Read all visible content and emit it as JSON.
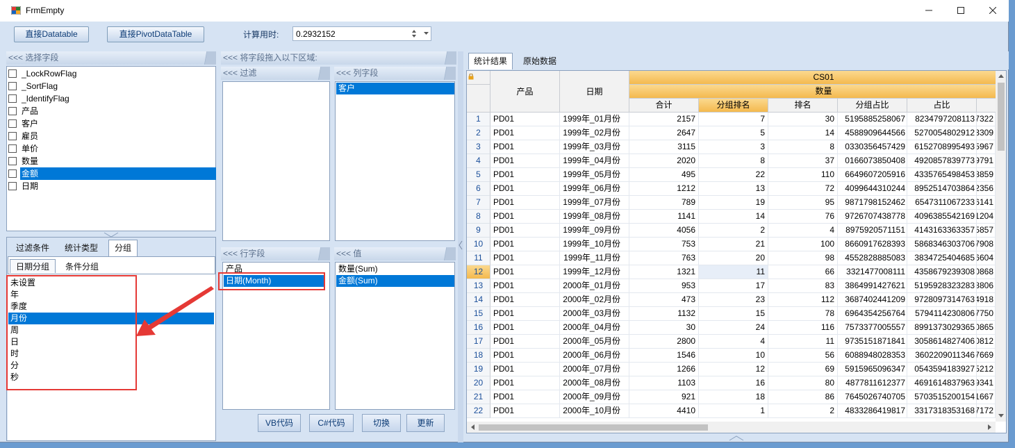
{
  "window": {
    "title": "FrmEmpty"
  },
  "toolbar": {
    "btn_datatable": "直接Datatable",
    "btn_pivot": "直接PivotDataTable",
    "calc_time_label": "计算用时:",
    "calc_time_value": "0.2932152"
  },
  "field_panel": {
    "header": "<<< 选择字段",
    "fields": [
      "_LockRowFlag",
      "_SortFlag",
      "_IdentifyFlag",
      "产品",
      "客户",
      "雇员",
      "单价",
      "数量",
      "金额",
      "日期"
    ],
    "selected_index": 8
  },
  "drag_header": "<<< 将字段拖入以下区域:",
  "filter_area": {
    "header": "<<< 过滤",
    "items": []
  },
  "column_area": {
    "header": "<<< 列字段",
    "items": [
      "客户"
    ]
  },
  "row_area": {
    "header": "<<< 行字段",
    "items": [
      "产品",
      "日期(Month)"
    ]
  },
  "value_area": {
    "header": "<<< 值",
    "items": [
      "数量(Sum)",
      "金额(Sum)"
    ]
  },
  "bottom_tabs": {
    "tabs": [
      "过滤条件",
      "统计类型",
      "分组"
    ],
    "active": 2,
    "subtabs": [
      "日期分组",
      "条件分组"
    ],
    "sub_active": 0
  },
  "group_options": {
    "items": [
      "未设置",
      "年",
      "季度",
      "月份",
      "周",
      "日",
      "时",
      "分",
      "秒"
    ],
    "selected_index": 3
  },
  "action_buttons": {
    "vb": "VB代码",
    "cs": "C#代码",
    "switch": "切换",
    "refresh": "更新"
  },
  "result_tabs": {
    "tabs": [
      "统计结果",
      "原始数据"
    ],
    "active": 0
  },
  "grid": {
    "col_product": "产品",
    "col_date": "日期",
    "band_top": "CS01",
    "band_mid": "数量",
    "subcols": [
      "合计",
      "分组排名",
      "排名",
      "分组占比",
      "占比"
    ],
    "rows": [
      {
        "n": "1",
        "p": "PD01",
        "d": "1999年_01月份",
        "t": "2157",
        "gr": "7",
        "r": "30",
        "gp": "5195885258067",
        "pp": "8234797208113",
        "x": "7322"
      },
      {
        "n": "2",
        "p": "PD01",
        "d": "1999年_02月份",
        "t": "2647",
        "gr": "5",
        "r": "14",
        "gp": "4588909644566",
        "pp": "5270054802912",
        "x": "3309"
      },
      {
        "n": "3",
        "p": "PD01",
        "d": "1999年_03月份",
        "t": "3115",
        "gr": "3",
        "r": "8",
        "gp": "0330356457429",
        "pp": "6152708995493",
        "x": "5967"
      },
      {
        "n": "4",
        "p": "PD01",
        "d": "1999年_04月份",
        "t": "2020",
        "gr": "8",
        "r": "37",
        "gp": "0166073850408",
        "pp": "4920857839773",
        "x": "9791"
      },
      {
        "n": "5",
        "p": "PD01",
        "d": "1999年_05月份",
        "t": "495",
        "gr": "22",
        "r": "110",
        "gp": "6649607205916",
        "pp": "4335765498453",
        "x": "8859"
      },
      {
        "n": "6",
        "p": "PD01",
        "d": "1999年_06月份",
        "t": "1212",
        "gr": "13",
        "r": "72",
        "gp": "4099644310244",
        "pp": "8952514703864",
        "x": "2356"
      },
      {
        "n": "7",
        "p": "PD01",
        "d": "1999年_07月份",
        "t": "789",
        "gr": "19",
        "r": "95",
        "gp": "9871798152462",
        "pp": "6547311067233",
        "x": "6141"
      },
      {
        "n": "8",
        "p": "PD01",
        "d": "1999年_08月份",
        "t": "1141",
        "gr": "14",
        "r": "76",
        "gp": "9726707438778",
        "pp": "4096385542169",
        "x": "1204"
      },
      {
        "n": "9",
        "p": "PD01",
        "d": "1999年_09月份",
        "t": "4056",
        "gr": "2",
        "r": "4",
        "gp": "8975920571151",
        "pp": "4143163363357",
        "x": "5857"
      },
      {
        "n": "10",
        "p": "PD01",
        "d": "1999年_10月份",
        "t": "753",
        "gr": "21",
        "r": "100",
        "gp": "8660917628393",
        "pp": "5868346303706",
        "x": "7908"
      },
      {
        "n": "11",
        "p": "PD01",
        "d": "1999年_11月份",
        "t": "763",
        "gr": "20",
        "r": "98",
        "gp": "4552828885083",
        "pp": "3834725404685",
        "x": "6604"
      },
      {
        "n": "12",
        "p": "PD01",
        "d": "1999年_12月份",
        "t": "1321",
        "gr": "11",
        "r": "66",
        "gp": "3321477008111",
        "pp": "4358679239308",
        "x": "0868"
      },
      {
        "n": "13",
        "p": "PD01",
        "d": "2000年_01月份",
        "t": "953",
        "gr": "17",
        "r": "83",
        "gp": "3864991427621",
        "pp": "5195928323283",
        "x": "8806"
      },
      {
        "n": "14",
        "p": "PD01",
        "d": "2000年_02月份",
        "t": "473",
        "gr": "23",
        "r": "112",
        "gp": "3687402441209",
        "pp": "9728097314763",
        "x": "4918"
      },
      {
        "n": "15",
        "p": "PD01",
        "d": "2000年_03月份",
        "t": "1132",
        "gr": "15",
        "r": "78",
        "gp": "6964354256764",
        "pp": "5794114230806",
        "x": "7750"
      },
      {
        "n": "16",
        "p": "PD01",
        "d": "2000年_04月份",
        "t": "30",
        "gr": "24",
        "r": "116",
        "gp": "7573377005557",
        "pp": "8991373029365",
        "x": "0865"
      },
      {
        "n": "17",
        "p": "PD01",
        "d": "2000年_05月份",
        "t": "2800",
        "gr": "4",
        "r": "11",
        "gp": "9735151871841",
        "pp": "3058614827406",
        "x": "0812"
      },
      {
        "n": "18",
        "p": "PD01",
        "d": "2000年_06月份",
        "t": "1546",
        "gr": "10",
        "r": "56",
        "gp": "6088948028353",
        "pp": "3602209011346",
        "x": "7669"
      },
      {
        "n": "19",
        "p": "PD01",
        "d": "2000年_07月份",
        "t": "1266",
        "gr": "12",
        "r": "69",
        "gp": "5915965096347",
        "pp": "0543594183927",
        "x": "5212"
      },
      {
        "n": "20",
        "p": "PD01",
        "d": "2000年_08月份",
        "t": "1103",
        "gr": "16",
        "r": "80",
        "gp": "4877811612377",
        "pp": "4691614837963",
        "x": "9341"
      },
      {
        "n": "21",
        "p": "PD01",
        "d": "2000年_09月份",
        "t": "921",
        "gr": "18",
        "r": "86",
        "gp": "7645026740705",
        "pp": "5703515200154",
        "x": "1667"
      },
      {
        "n": "22",
        "p": "PD01",
        "d": "2000年_10月份",
        "t": "4410",
        "gr": "1",
        "r": "2",
        "gp": "4833286419817",
        "pp": "3317318353168",
        "x": "7172"
      }
    ],
    "selected_row": 12
  },
  "colors": {
    "accent": "#0078d7",
    "highlight_red": "#e53935",
    "header_orange": "#f8c66a"
  }
}
